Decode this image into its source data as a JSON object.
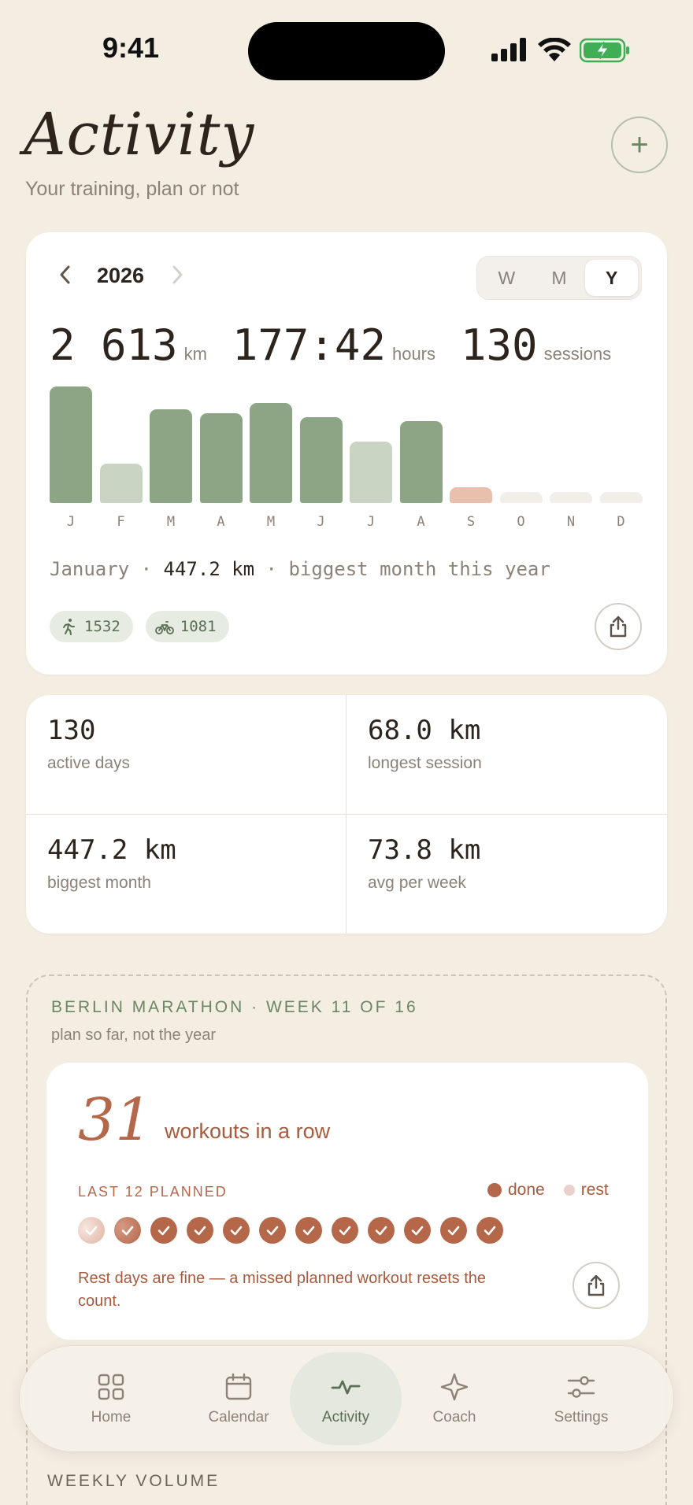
{
  "status": {
    "time": "9:41"
  },
  "header": {
    "title": "Activity",
    "subtitle": "Your training, plan or not"
  },
  "year_card": {
    "year": "2026",
    "segments": [
      "W",
      "M",
      "Y"
    ],
    "active_segment": "Y",
    "totals": [
      {
        "value": "2 613",
        "unit": "km"
      },
      {
        "value": "177:42",
        "unit": "hours"
      },
      {
        "value": "130",
        "unit": "sessions"
      }
    ],
    "highlight": {
      "month": "January",
      "value": "447.2 km",
      "note": "biggest month this year"
    },
    "chips": [
      {
        "icon": "running-icon",
        "value": "1532"
      },
      {
        "icon": "cycling-icon",
        "value": "1081"
      }
    ]
  },
  "chart_data": {
    "type": "bar",
    "categories": [
      "J",
      "F",
      "M",
      "A",
      "M",
      "J",
      "J",
      "A",
      "S",
      "O",
      "N",
      "D"
    ],
    "values": [
      447.2,
      150,
      360,
      345,
      385,
      330,
      235,
      315,
      60,
      0,
      0,
      0
    ],
    "ylim": [
      0,
      447.2
    ],
    "bar_status": [
      "done",
      "partial",
      "done",
      "done",
      "done",
      "done",
      "partial",
      "done",
      "current",
      "future",
      "future",
      "future"
    ],
    "colors": {
      "done": "#8ea585",
      "partial": "#c9d4c2",
      "current": "#e8c0ad",
      "future": "#f2eeea"
    }
  },
  "stats": [
    {
      "value": "130",
      "label": "active days"
    },
    {
      "value": "68.0 km",
      "label": "longest session"
    },
    {
      "value": "447.2 km",
      "label": "biggest month"
    },
    {
      "value": "73.8 km",
      "label": "avg per week"
    }
  ],
  "plan": {
    "title": "BERLIN MARATHON · WEEK 11 OF 16",
    "subtitle": "plan so far, not the year",
    "streak_value": "31",
    "streak_label": "workouts in a row",
    "last_label": "LAST 12 PLANNED",
    "legend_done": "done",
    "legend_rest": "rest",
    "workouts": [
      "faded",
      "partial",
      "done",
      "done",
      "done",
      "done",
      "done",
      "done",
      "done",
      "done",
      "done",
      "done"
    ],
    "note": "Rest days are fine — a missed planned workout resets the count.",
    "weekly_label": "WEEKLY VOLUME"
  },
  "tabs": [
    {
      "label": "Home",
      "icon": "grid-icon"
    },
    {
      "label": "Calendar",
      "icon": "calendar-icon"
    },
    {
      "label": "Activity",
      "icon": "activity-icon"
    },
    {
      "label": "Coach",
      "icon": "sparkle-icon"
    },
    {
      "label": "Settings",
      "icon": "sliders-icon"
    }
  ],
  "active_tab": "Activity",
  "colors": {
    "background": "#f4ede2",
    "accent_green": "#8ea585",
    "accent_terracotta": "#b5674a"
  }
}
